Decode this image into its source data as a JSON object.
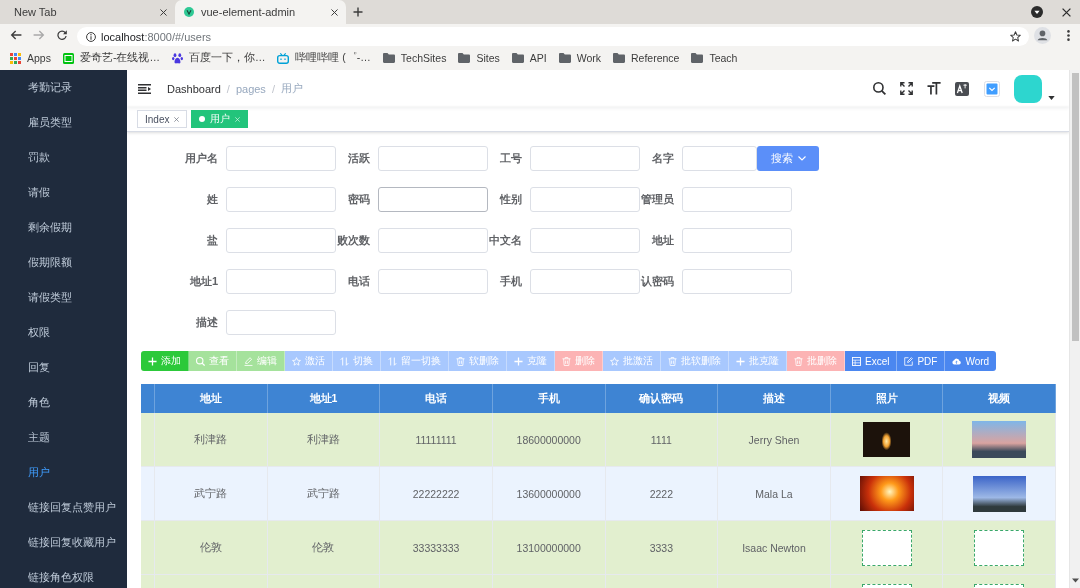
{
  "browser": {
    "tabs": [
      {
        "title": "New Tab",
        "kind": "blank",
        "selected": false
      },
      {
        "title": "vue-element-admin",
        "kind": "page",
        "selected": true
      }
    ],
    "navigation": [
      {
        "kind": "back",
        "disabled": false
      },
      {
        "kind": "forward",
        "disabled": true
      },
      {
        "kind": "reload",
        "disabled": false
      }
    ],
    "address": {
      "host": "localhost",
      "path": ":8000/#/users"
    },
    "bookmarks": [
      {
        "label": "Apps",
        "kind": "apps"
      },
      {
        "label": "爱奇艺-在线视…",
        "kind": "site"
      },
      {
        "label": "百度一下，你…",
        "kind": "paw"
      },
      {
        "label": "哔哩哔哩 (゜-…",
        "kind": "tv"
      },
      {
        "label": "TechSites",
        "kind": "folder"
      },
      {
        "label": "Sites",
        "kind": "folder"
      },
      {
        "label": "API",
        "kind": "folder"
      },
      {
        "label": "Work",
        "kind": "folder"
      },
      {
        "label": "Reference",
        "kind": "folder"
      },
      {
        "label": "Teach",
        "kind": "folder"
      }
    ]
  },
  "sidebar": {
    "items": [
      {
        "label": "考勤记录",
        "selected": false
      },
      {
        "label": "雇员类型",
        "selected": false
      },
      {
        "label": "罚款",
        "selected": false
      },
      {
        "label": "请假",
        "selected": false
      },
      {
        "label": "剩余假期",
        "selected": false
      },
      {
        "label": "假期限额",
        "selected": false
      },
      {
        "label": "请假类型",
        "selected": false
      },
      {
        "label": "权限",
        "selected": false
      },
      {
        "label": "回复",
        "selected": false
      },
      {
        "label": "角色",
        "selected": false
      },
      {
        "label": "主题",
        "selected": false
      },
      {
        "label": "用户",
        "selected": true
      },
      {
        "label": "链接回复点赞用户",
        "selected": false
      },
      {
        "label": "链接回复收藏用户",
        "selected": false
      },
      {
        "label": "链接角色权限",
        "selected": false
      }
    ]
  },
  "navbar": {
    "breadcrumb": [
      {
        "label": "Dashboard",
        "kind": "link"
      },
      {
        "label": "/",
        "kind": "separator"
      },
      {
        "label": "pages",
        "kind": "text"
      },
      {
        "label": "/",
        "kind": "separator"
      },
      {
        "label": "用户",
        "kind": "text"
      }
    ]
  },
  "tags": [
    {
      "label": "Index",
      "selected": false
    },
    {
      "label": "用户",
      "selected": true
    }
  ],
  "form": {
    "rows": [
      [
        {
          "label": "用户名",
          "hovered": false
        },
        {
          "label": "活跃",
          "hovered": false
        },
        {
          "label": "工号",
          "hovered": false
        },
        {
          "label": "名字",
          "hovered": false
        }
      ],
      [
        {
          "label": "姓",
          "hovered": false
        },
        {
          "label": "密码",
          "hovered": true
        },
        {
          "label": "性别",
          "hovered": false
        },
        {
          "label": "管理员",
          "hovered": false
        }
      ],
      [
        {
          "label": "盐",
          "hovered": false
        },
        {
          "label": "败次数",
          "hovered": false
        },
        {
          "label": "中文名",
          "hovered": false
        },
        {
          "label": "地址",
          "hovered": false
        }
      ],
      [
        {
          "label": "地址1",
          "hovered": false
        },
        {
          "label": "电话",
          "hovered": false
        },
        {
          "label": "手机",
          "hovered": false
        },
        {
          "label": "认密码",
          "hovered": false
        }
      ],
      [
        {
          "label": "描述",
          "hovered": false
        }
      ]
    ],
    "search_button": {
      "label": "搜索"
    }
  },
  "toolbar": {
    "buttons": [
      {
        "label": "添加",
        "kind": "add",
        "disabled": false
      },
      {
        "label": "查看",
        "kind": "view",
        "disabled": true
      },
      {
        "label": "编辑",
        "kind": "edit",
        "disabled": true
      },
      {
        "label": "激活",
        "kind": "activate",
        "disabled": true
      },
      {
        "label": "切换",
        "kind": "switch",
        "disabled": true
      },
      {
        "label": "留一切换",
        "kind": "switch",
        "disabled": true
      },
      {
        "label": "软删除",
        "kind": "softdelete",
        "disabled": true
      },
      {
        "label": "克隆",
        "kind": "clone",
        "disabled": true
      },
      {
        "label": "删除",
        "kind": "delete",
        "disabled": true
      },
      {
        "label": "批激活",
        "kind": "activate",
        "disabled": true
      },
      {
        "label": "批软删除",
        "kind": "softdelete",
        "disabled": true
      },
      {
        "label": "批克隆",
        "kind": "clone",
        "disabled": true
      },
      {
        "label": "批删除",
        "kind": "delete",
        "disabled": true
      },
      {
        "label": "Excel",
        "kind": "excel",
        "disabled": false
      },
      {
        "label": "PDF",
        "kind": "pdf",
        "disabled": false
      },
      {
        "label": "Word",
        "kind": "word",
        "disabled": false
      }
    ]
  },
  "table": {
    "columns": [
      {
        "label": "地址",
        "kind": "text"
      },
      {
        "label": "地址1",
        "kind": "text"
      },
      {
        "label": "电话",
        "kind": "text"
      },
      {
        "label": "手机",
        "kind": "text"
      },
      {
        "label": "确认密码",
        "kind": "text"
      },
      {
        "label": "描述",
        "kind": "text"
      },
      {
        "label": "照片",
        "kind": "image"
      },
      {
        "label": "视频",
        "kind": "image"
      }
    ],
    "rows": [
      {
        "cells": [
          "利津路",
          "利津路",
          "11111111",
          "18600000000",
          "1111",
          "Jerry Shen"
        ],
        "selected": false
      },
      {
        "cells": [
          "武宁路",
          "武宁路",
          "22222222",
          "13600000000",
          "2222",
          "Mala La"
        ],
        "selected": true
      },
      {
        "cells": [
          "伦敦",
          "伦敦",
          "33333333",
          "13100000000",
          "3333",
          "Isaac Newton"
        ],
        "selected": false
      },
      {
        "selected": false
      }
    ]
  }
}
